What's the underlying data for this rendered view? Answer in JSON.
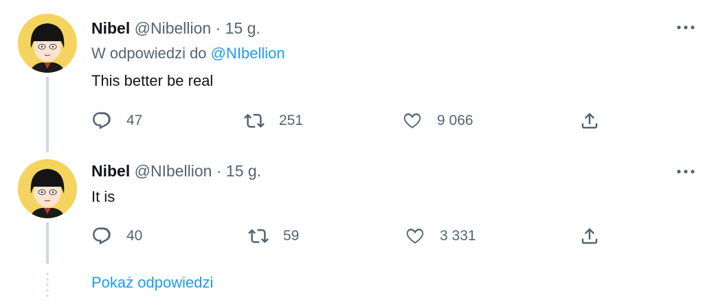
{
  "tweets": [
    {
      "name": "Nibel",
      "handle": "@Nibellion",
      "sep": " · ",
      "time": "15 g.",
      "reply_prefix": "W odpowiedzi do ",
      "reply_mention": "@NIbellion",
      "text": "This better be real",
      "reply_count": "47",
      "retweet_count": "251",
      "like_count": "9 066"
    },
    {
      "name": "Nibel",
      "handle": "@NIbellion",
      "sep": " · ",
      "time": "15 g.",
      "text": "It is",
      "reply_count": "40",
      "retweet_count": "59",
      "like_count": "3 331"
    }
  ],
  "show_replies_label": "Pokaż odpowiedzi",
  "colors": {
    "accent": "#1d9bf0",
    "secondary_text": "#536471",
    "primary_text": "#0f1419",
    "avatar_bg": "#f4d45e",
    "thread_line": "#cfd9de"
  }
}
